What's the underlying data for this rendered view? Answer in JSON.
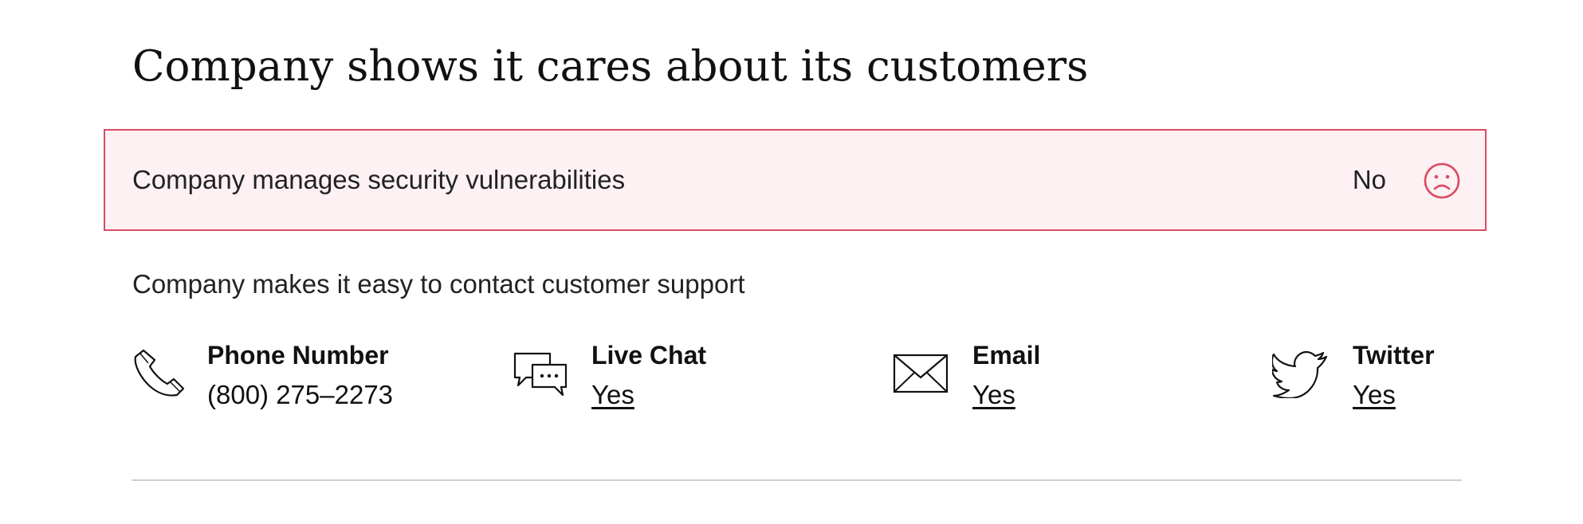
{
  "section": {
    "title": "Company shows it cares about its customers"
  },
  "security": {
    "label": "Company manages security vulnerabilities",
    "answer": "No",
    "status_icon": "sad-face-icon",
    "accent_color": "#dc4b64",
    "background_color": "#fdf1f3"
  },
  "support": {
    "label": "Company makes it easy to contact customer support",
    "channels": [
      {
        "icon": "phone-icon",
        "title": "Phone Number",
        "value": "(800) 275–2273"
      },
      {
        "icon": "chat-bubbles-icon",
        "title": "Live Chat",
        "value": "Yes"
      },
      {
        "icon": "envelope-icon",
        "title": "Email",
        "value": "Yes"
      },
      {
        "icon": "twitter-bird-icon",
        "title": "Twitter",
        "value": "Yes"
      }
    ]
  }
}
